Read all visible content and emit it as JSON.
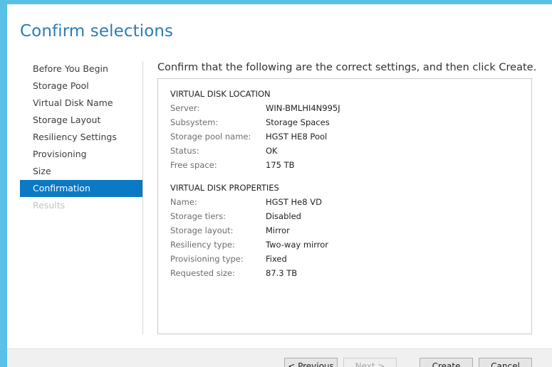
{
  "wizard": {
    "title": "Confirm selections",
    "instruction": "Confirm that the following are the correct settings, and then click Create."
  },
  "nav": {
    "items": [
      {
        "label": "Before You Begin"
      },
      {
        "label": "Storage Pool"
      },
      {
        "label": "Virtual Disk Name"
      },
      {
        "label": "Storage Layout"
      },
      {
        "label": "Resiliency Settings"
      },
      {
        "label": "Provisioning"
      },
      {
        "label": "Size"
      },
      {
        "label": "Confirmation"
      },
      {
        "label": "Results"
      }
    ],
    "active_index": 7,
    "disabled_index": 8
  },
  "location": {
    "header": "VIRTUAL DISK LOCATION",
    "rows": [
      {
        "label": "Server:",
        "value": "WIN-BMLHI4N995J"
      },
      {
        "label": "Subsystem:",
        "value": "Storage Spaces"
      },
      {
        "label": "Storage pool name:",
        "value": "HGST HE8 Pool"
      },
      {
        "label": "Status:",
        "value": "OK"
      },
      {
        "label": "Free space:",
        "value": "175 TB"
      }
    ]
  },
  "properties": {
    "header": "VIRTUAL DISK PROPERTIES",
    "rows": [
      {
        "label": "Name:",
        "value": "HGST He8 VD"
      },
      {
        "label": "Storage tiers:",
        "value": "Disabled"
      },
      {
        "label": "Storage layout:",
        "value": "Mirror"
      },
      {
        "label": "Resiliency type:",
        "value": "Two-way mirror"
      },
      {
        "label": "Provisioning type:",
        "value": "Fixed"
      },
      {
        "label": "Requested size:",
        "value": "87.3 TB"
      }
    ]
  },
  "buttons": {
    "previous": "< Previous",
    "next": "Next >",
    "create": "Create",
    "cancel": "Cancel"
  },
  "colors": {
    "accent": "#0b79c4",
    "title": "#2a7db6",
    "frame": "#5bc0e6"
  }
}
